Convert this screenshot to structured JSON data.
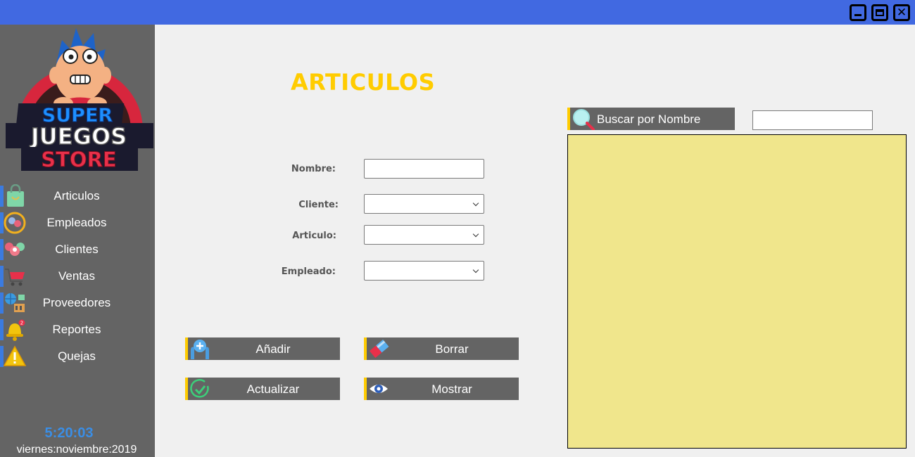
{
  "window": {
    "controls": {
      "minimize_icon": "minimize-icon",
      "maximize_icon": "maximize-icon",
      "close_icon": "close-icon",
      "close_glyph": "✕"
    }
  },
  "sidebar": {
    "logo": {
      "line1": "SUPER",
      "line2": "JUEGOS",
      "line3": "STORE"
    },
    "items": [
      {
        "label": "Articulos",
        "icon": "shopping-bag-icon"
      },
      {
        "label": "Empleados",
        "icon": "employees-icon"
      },
      {
        "label": "Clientes",
        "icon": "clients-icon"
      },
      {
        "label": "Ventas",
        "icon": "shopping-cart-icon"
      },
      {
        "label": "Proveedores",
        "icon": "suppliers-icon"
      },
      {
        "label": "Reportes",
        "icon": "bell-icon"
      },
      {
        "label": "Quejas",
        "icon": "warning-icon"
      }
    ],
    "clock": "5:20:03",
    "date": "viernes:noviembre:2019"
  },
  "main": {
    "title": "ARTICULOS",
    "form": {
      "nombre_label": "Nombre:",
      "nombre_value": "",
      "cliente_label": "Cliente:",
      "cliente_value": "",
      "articulo_label": "Articulo:",
      "articulo_value": "",
      "empleado_label": "Empleado:",
      "empleado_value": ""
    },
    "buttons": {
      "add": "Añadir",
      "delete": "Borrar",
      "update": "Actualizar",
      "show": "Mostrar"
    },
    "search": {
      "label": "Buscar por Nombre",
      "value": ""
    }
  },
  "colors": {
    "titlebar": "#4169e1",
    "sidebar": "#646464",
    "accent": "#ffcc00",
    "results_bg": "#f0e68c",
    "clock": "#3a8ee6"
  }
}
